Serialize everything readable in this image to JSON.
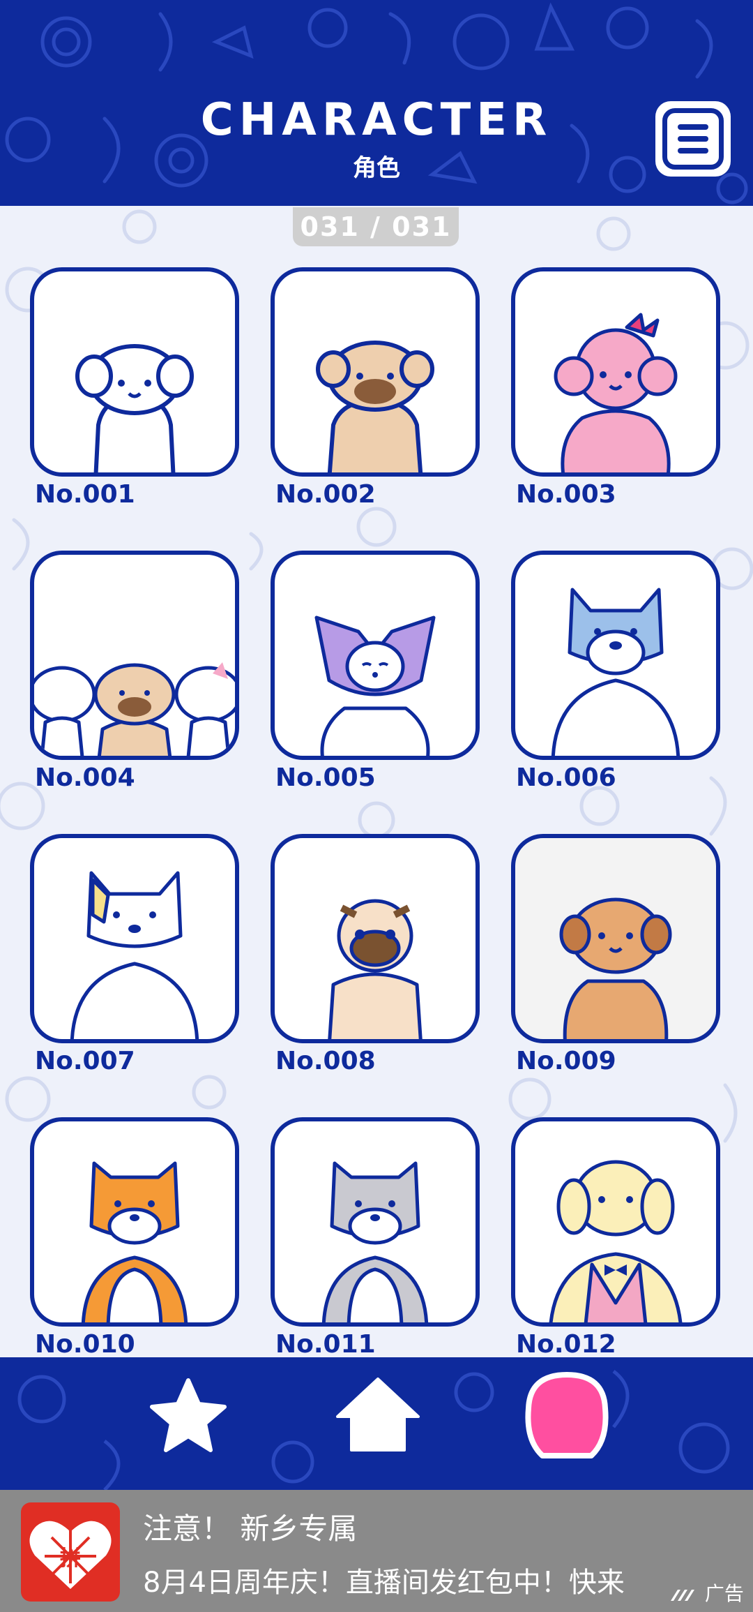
{
  "header": {
    "title": "CHARACTER",
    "subtitle": "角色",
    "menu_icon": "hamburger-menu-icon"
  },
  "counter": "031 / 031",
  "characters": [
    {
      "label": "No.001",
      "fur": "#ffffff",
      "accent": "#ffffff"
    },
    {
      "label": "No.002",
      "fur": "#eecfae",
      "accent": "#8a5c3a"
    },
    {
      "label": "No.003",
      "fur": "#f6a9c8",
      "accent": "#e8407c"
    },
    {
      "label": "No.004",
      "fur": "#eecfae",
      "accent": "#8a5c3a"
    },
    {
      "label": "No.005",
      "fur": "#ffffff",
      "accent": "#b79be6"
    },
    {
      "label": "No.006",
      "fur": "#ffffff",
      "accent": "#9cc0ea"
    },
    {
      "label": "No.007",
      "fur": "#ffffff",
      "accent": "#f6e08a"
    },
    {
      "label": "No.008",
      "fur": "#f7e0c8",
      "accent": "#7a5230"
    },
    {
      "label": "No.009",
      "fur": "#e7a871",
      "accent": "#c27a45"
    },
    {
      "label": "No.010",
      "fur": "#ffffff",
      "accent": "#f59a36"
    },
    {
      "label": "No.011",
      "fur": "#ffffff",
      "accent": "#c9c9d0"
    },
    {
      "label": "No.012",
      "fur": "#fbefb9",
      "accent": "#f3a7c4"
    }
  ],
  "colors": {
    "brand_blue": "#0e2a9c",
    "card_border": "#0e2a9c",
    "active_tab": "#ff4fa0",
    "ad_background": "#8a8a8a"
  },
  "bottom_nav": {
    "items": [
      {
        "icon": "star-icon",
        "active": false
      },
      {
        "icon": "home-icon",
        "active": false
      },
      {
        "icon": "dog-face-icon",
        "active": true
      }
    ]
  },
  "ad": {
    "line1": "注意！ 新乡专属",
    "line2": "8月4日周年庆！直播间发红包中！快来",
    "tag": "广告",
    "logo_text": "拼"
  }
}
